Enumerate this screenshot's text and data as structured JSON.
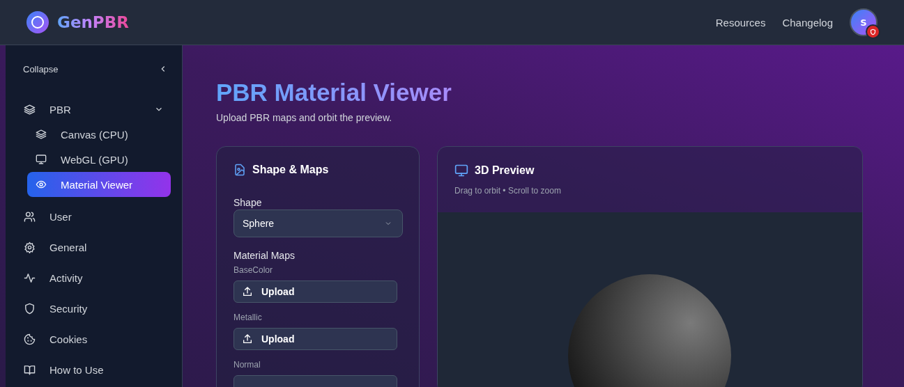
{
  "header": {
    "brand": "GenPBR",
    "links": [
      "Resources",
      "Changelog"
    ],
    "avatar": "S"
  },
  "sidebar": {
    "collapse": "Collapse",
    "items": [
      {
        "label": "PBR",
        "expanded": true,
        "selected": false,
        "children": [
          {
            "label": "Canvas (CPU)",
            "selected": false
          },
          {
            "label": "WebGL (GPU)",
            "selected": false
          },
          {
            "label": "Material Viewer",
            "selected": true
          }
        ]
      },
      {
        "label": "User",
        "selected": false
      },
      {
        "label": "General",
        "selected": false
      },
      {
        "label": "Activity",
        "selected": false
      },
      {
        "label": "Security",
        "selected": false
      },
      {
        "label": "Cookies",
        "selected": false
      },
      {
        "label": "How to Use",
        "selected": false
      }
    ]
  },
  "page": {
    "title": "PBR Material Viewer",
    "subtitle": "Upload PBR maps and orbit the preview."
  },
  "maps_card": {
    "title": "Shape & Maps",
    "shape_label": "Shape",
    "shape_value": "Sphere",
    "maps_label": "Material Maps",
    "maps": [
      {
        "name": "BaseColor",
        "button": "Upload"
      },
      {
        "name": "Metallic",
        "button": "Upload"
      },
      {
        "name": "Normal"
      }
    ]
  },
  "preview_card": {
    "title": "3D Preview",
    "hint": "Drag to orbit • Scroll to zoom"
  }
}
